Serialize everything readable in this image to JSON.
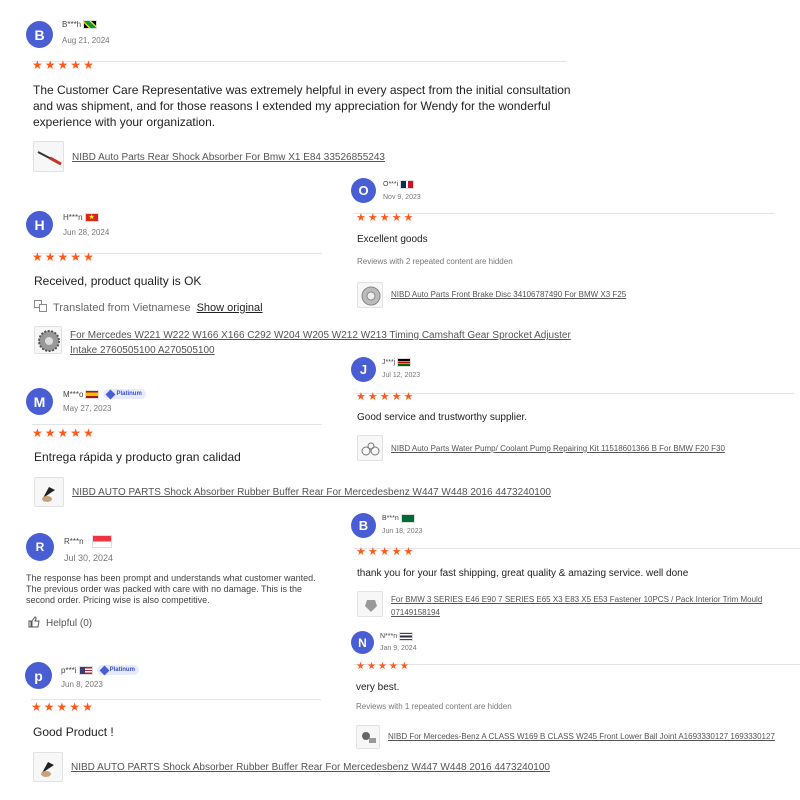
{
  "colors": {
    "avatar": "#4a5ed4",
    "star": "#ff5a1a",
    "badge": "#e8ebff"
  },
  "reviews": [
    {
      "initial": "B",
      "name": "B***h",
      "flag": "jamaica-flag",
      "date": "Aug 21, 2024",
      "stars": 5,
      "text": "The Customer Care Representative was extremely helpful in every aspect from the initial consultation and was shipment, and for those reasons I extended my appreciation for Wendy for the wonderful experience with your organization.",
      "product": "NIBD Auto Parts Rear Shock Absorber For Bmw X1 E84 33526855243",
      "product_icon": "shock-absorber-icon"
    },
    {
      "initial": "O",
      "name": "O***i",
      "flag": "dominican-republic-flag",
      "date": "Nov 9, 2023",
      "stars": 5,
      "text": "Excellent goods",
      "note": "Reviews with 2 repeated content are hidden",
      "product": "NIBD Auto Parts Front Brake Disc 34106787490 For BMW X3 F25",
      "product_icon": "brake-disc-icon"
    },
    {
      "initial": "H",
      "name": "H***n",
      "flag": "vietnam-flag",
      "date": "Jun 28, 2024",
      "stars": 5,
      "text": "Received, product quality is OK",
      "translated_label": "Translated from Vietnamese",
      "show_original": "Show original",
      "product": "For Mercedes W221 W222 W166 X166 C292 W204 W205 W212 W213 Timing Camshaft Gear Sprocket Adjuster Intake 2760505100 A270505100",
      "product_icon": "camshaft-gear-icon"
    },
    {
      "initial": "J",
      "name": "J***j",
      "flag": "kenya-flag",
      "date": "Jul 12, 2023",
      "stars": 5,
      "text": "Good service and trustworthy supplier.",
      "product": "NIBD Auto Parts Water Pump/ Coolant Pump Repairing Kit 11518601366 B For BMW F20 F30",
      "product_icon": "water-pump-icon"
    },
    {
      "initial": "M",
      "name": "M***o",
      "flag": "spain-flag",
      "badge": "Platinum",
      "date": "May 27, 2023",
      "stars": 5,
      "text": "Entrega rápida y producto gran calidad",
      "product": "NIBD AUTO PARTS Shock Absorber Rubber Buffer Rear For Mercedesbenz W447 W448 2016 4473240100",
      "product_icon": "rubber-buffer-icon"
    },
    {
      "initial": "B",
      "name": "B***n",
      "flag": "saudi-arabia-flag",
      "date": "Jun 18, 2023",
      "stars": 5,
      "text": "thank you for your fast shipping, great quality & amazing service. well done",
      "product": "For BMW 3 SERIES E46 E90 7 SERIES E65 X3 E83 X5 E53 Fastener 10PCS / Pack Interior Trim Mould 07149158194",
      "product_icon": "fastener-clip-icon"
    },
    {
      "initial": "R",
      "name": "R***n",
      "flag": "singapore-flag",
      "date": "Jul 30, 2024",
      "text": "The response has been prompt and understands what customer wanted. The previous order was packed with care with no damage. This is the second order. Pricing wise is also competitive.",
      "helpful": "Helpful (0)"
    },
    {
      "initial": "N",
      "name": "N***n",
      "flag": "thailand-flag",
      "date": "Jan 9, 2024",
      "stars": 5,
      "text": "very best.",
      "note": "Reviews with 1 repeated content are hidden",
      "product": "NIBD For Mercedes-Benz A CLASS W169 B CLASS W245 Front Lower Ball Joint A1693330127 1693330127",
      "product_icon": "ball-joint-icon"
    },
    {
      "initial": "p",
      "name": "p***i",
      "flag": "usa-flag",
      "badge": "Platinum",
      "date": "Jun 8, 2023",
      "stars": 5,
      "text": "Good Product !",
      "product": "NIBD AUTO PARTS Shock Absorber Rubber Buffer Rear For Mercedesbenz W447 W448 2016 4473240100",
      "product_icon": "rubber-buffer-icon"
    }
  ]
}
